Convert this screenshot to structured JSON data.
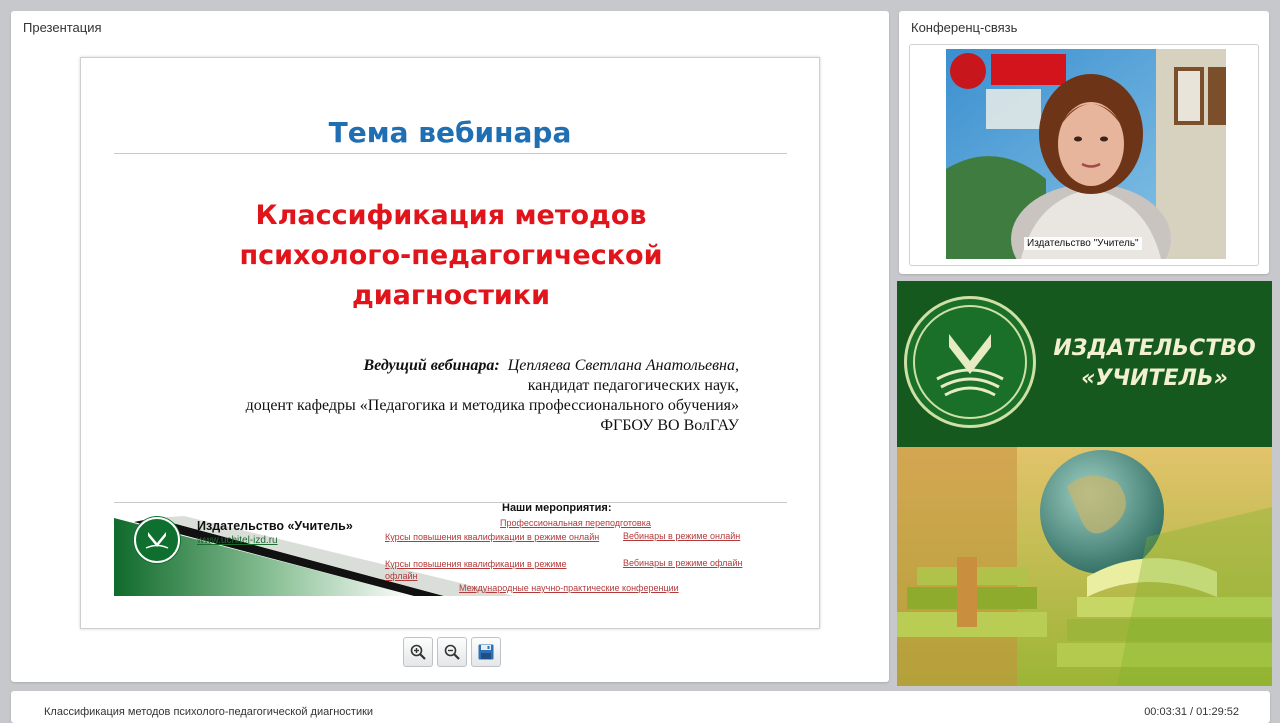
{
  "presentation_panel": {
    "title": "Презентация"
  },
  "slide": {
    "heading": "Тема вебинара",
    "topic_lines": [
      "Классификация методов",
      "психолого-педагогической",
      "диагностики"
    ],
    "presenter_label": "Ведущий вебинара",
    "presenter_name": "Цепляева Светлана Анатольевна,",
    "presenter_lines": [
      "кандидат педагогических наук,",
      "доцент кафедры «Педагогика и методика профессионального обучения»",
      "ФГБОУ ВО ВолГАУ"
    ],
    "publisher_name": "Издательство «Учитель»",
    "publisher_url": "www.uchitel-izd.ru",
    "events_title": "Наши мероприятия",
    "events": [
      "Профессиональная переподготовка",
      "Курсы повышения квалификации в режиме онлайн",
      "Вебинары в режиме онлайн",
      "Курсы повышения квалификации в режиме офлайн",
      "Вебинары в режиме офлайн",
      "Международные научно-практические конференции"
    ]
  },
  "zoom_controls": {
    "icons": [
      "zoom-in-icon",
      "zoom-out-icon",
      "save-icon"
    ]
  },
  "conference_panel": {
    "title": "Конференц-связь",
    "video_caption": "Издательство \"Учитель\""
  },
  "banner": {
    "line1": "ИЗДАТЕЛЬСТВО",
    "line2": "«УЧИТЕЛЬ»"
  },
  "bottom_bar": {
    "title": "Классификация методов психолого-педагогической диагностики",
    "time": "00:03:31 / 01:29:52"
  },
  "colors": {
    "heading": "#1f6fb2",
    "topic": "#e0141a",
    "banner_green": "#15591f",
    "link_red": "#b33a3a"
  }
}
